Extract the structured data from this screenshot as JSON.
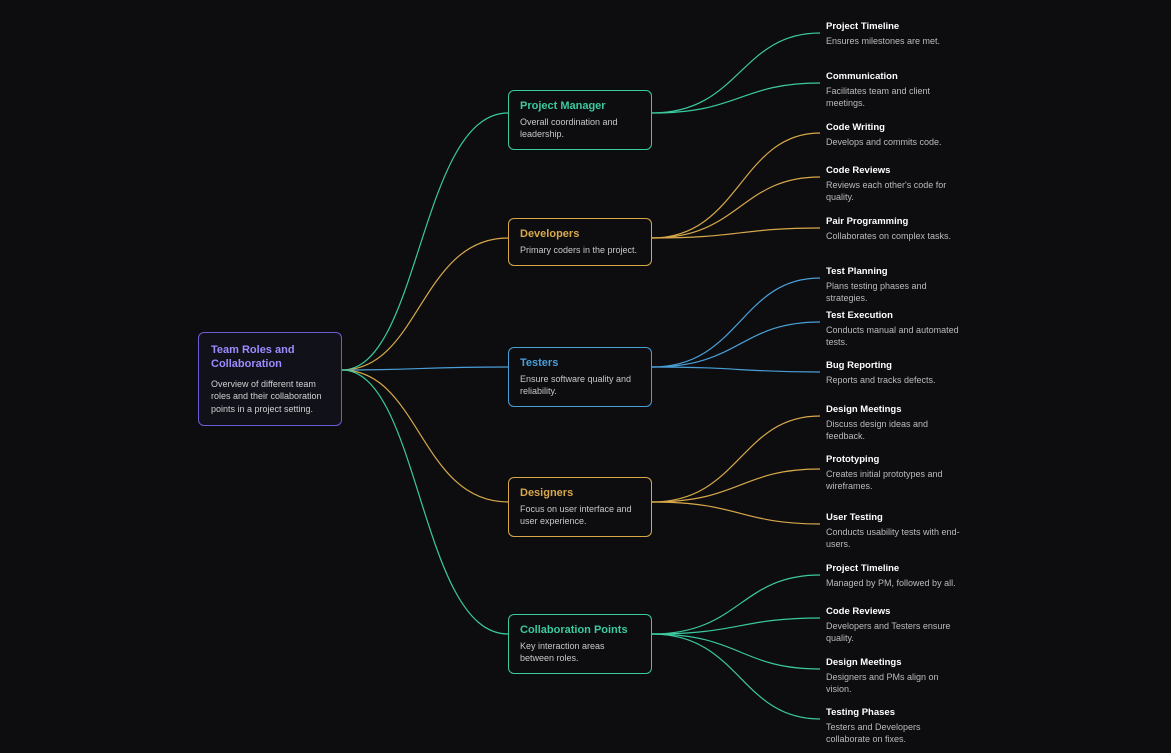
{
  "root": {
    "t": "Team Roles and Collaboration",
    "d": "Overview of different team roles and their collaboration points in a project setting."
  },
  "b": [
    {
      "t": "Project Manager",
      "d": "Overall coordination and leadership.",
      "c": "#3bc99e",
      "leaves": [
        {
          "t": "Project Timeline",
          "d": "Ensures milestones are met."
        },
        {
          "t": "Communication",
          "d": "Facilitates team and client meetings."
        }
      ]
    },
    {
      "t": "Developers",
      "d": "Primary coders in the project.",
      "c": "#d7a84a",
      "leaves": [
        {
          "t": "Code Writing",
          "d": "Develops and commits code."
        },
        {
          "t": "Code Reviews",
          "d": "Reviews each other's code for quality."
        },
        {
          "t": "Pair Programming",
          "d": "Collaborates on complex tasks."
        }
      ]
    },
    {
      "t": "Testers",
      "d": "Ensure software quality and reliability.",
      "c": "#4a9fd7",
      "leaves": [
        {
          "t": "Test Planning",
          "d": "Plans testing phases and strategies."
        },
        {
          "t": "Test Execution",
          "d": "Conducts manual and automated tests."
        },
        {
          "t": "Bug Reporting",
          "d": "Reports and tracks defects."
        }
      ]
    },
    {
      "t": "Designers",
      "d": "Focus on user interface and user experience.",
      "c": "#d7a84a",
      "leaves": [
        {
          "t": "Design Meetings",
          "d": "Discuss design ideas and feedback."
        },
        {
          "t": "Prototyping",
          "d": "Creates initial prototypes and wireframes."
        },
        {
          "t": "User Testing",
          "d": "Conducts usability tests with end-users."
        }
      ]
    },
    {
      "t": "Collaboration Points",
      "d": "Key interaction areas between roles.",
      "c": "#3bc99e",
      "leaves": [
        {
          "t": "Project Timeline",
          "d": "Managed by PM, followed by all."
        },
        {
          "t": "Code Reviews",
          "d": "Developers and Testers ensure quality."
        },
        {
          "t": "Design Meetings",
          "d": "Designers and PMs align on vision."
        },
        {
          "t": "Testing Phases",
          "d": "Testers and Developers collaborate on fixes."
        }
      ]
    }
  ]
}
